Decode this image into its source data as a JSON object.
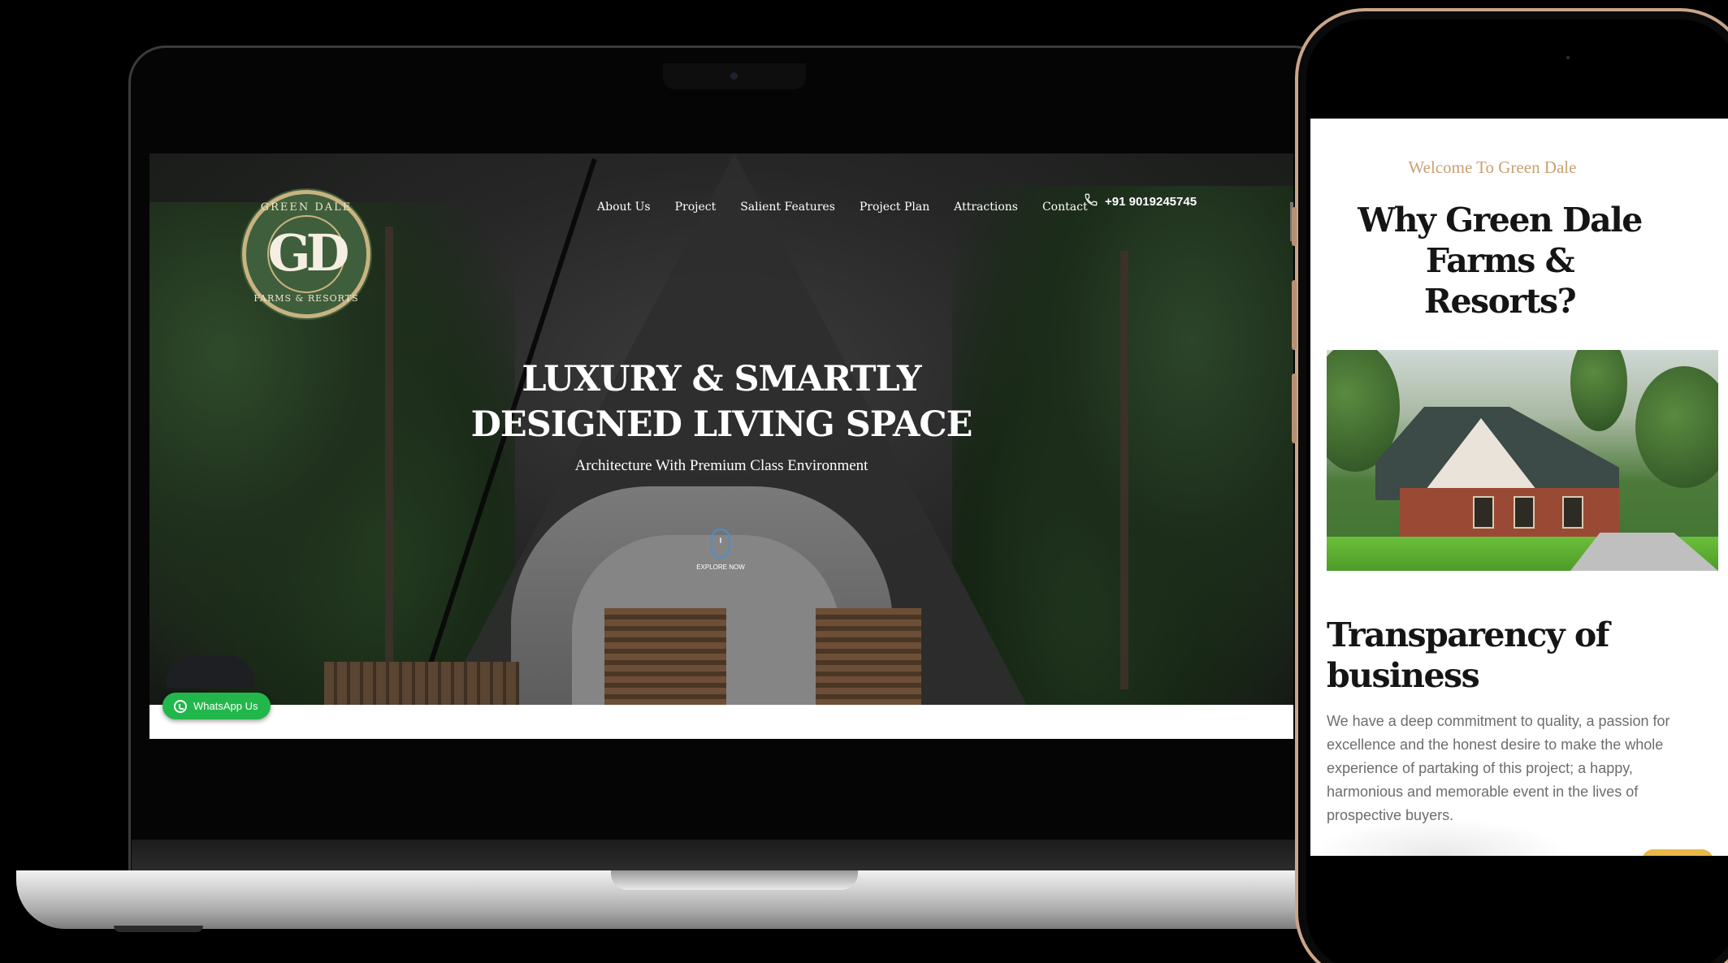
{
  "laptop": {
    "site": {
      "logo": {
        "top_text": "GREEN DALE",
        "monogram": "GD",
        "bottom_text": "FARMS & RESORTS"
      },
      "nav": {
        "items": [
          {
            "label": "About Us"
          },
          {
            "label": "Project"
          },
          {
            "label": "Salient Features"
          },
          {
            "label": "Project Plan"
          },
          {
            "label": "Attractions"
          },
          {
            "label": "Contact"
          }
        ]
      },
      "contact": {
        "icon": "phone-icon",
        "phone": "+91 9019245745"
      },
      "hero": {
        "title_line1": "LUXURY & SMARTLY",
        "title_line2": "DESIGNED LIVING SPACE",
        "subtitle": "Architecture With Premium Class Environment",
        "explore_icon": "mouse-scroll-icon",
        "explore_label": "EXPLORE NOW"
      },
      "whatsapp": {
        "icon": "whatsapp-icon",
        "label": "WhatsApp Us",
        "color": "#22b74b"
      }
    }
  },
  "phone": {
    "welcome": "Welcome To Green Dale",
    "heading_line1": "Why Green Dale Farms &",
    "heading_line2": "Resorts?",
    "section_title_line1": "Transparency of",
    "section_title_line2": "business",
    "section_body": "We have a deep commitment to quality, a passion for excellence and the honest desire to make the whole experience of partaking of this project; a happy, harmonious and memorable event in the lives of prospective buyers."
  },
  "colors": {
    "accent_gold": "#c9a173",
    "logo_green": "#3f5e3c",
    "whatsapp_green": "#22b74b",
    "heading_text": "#151515",
    "body_text": "#6d6d6d"
  }
}
